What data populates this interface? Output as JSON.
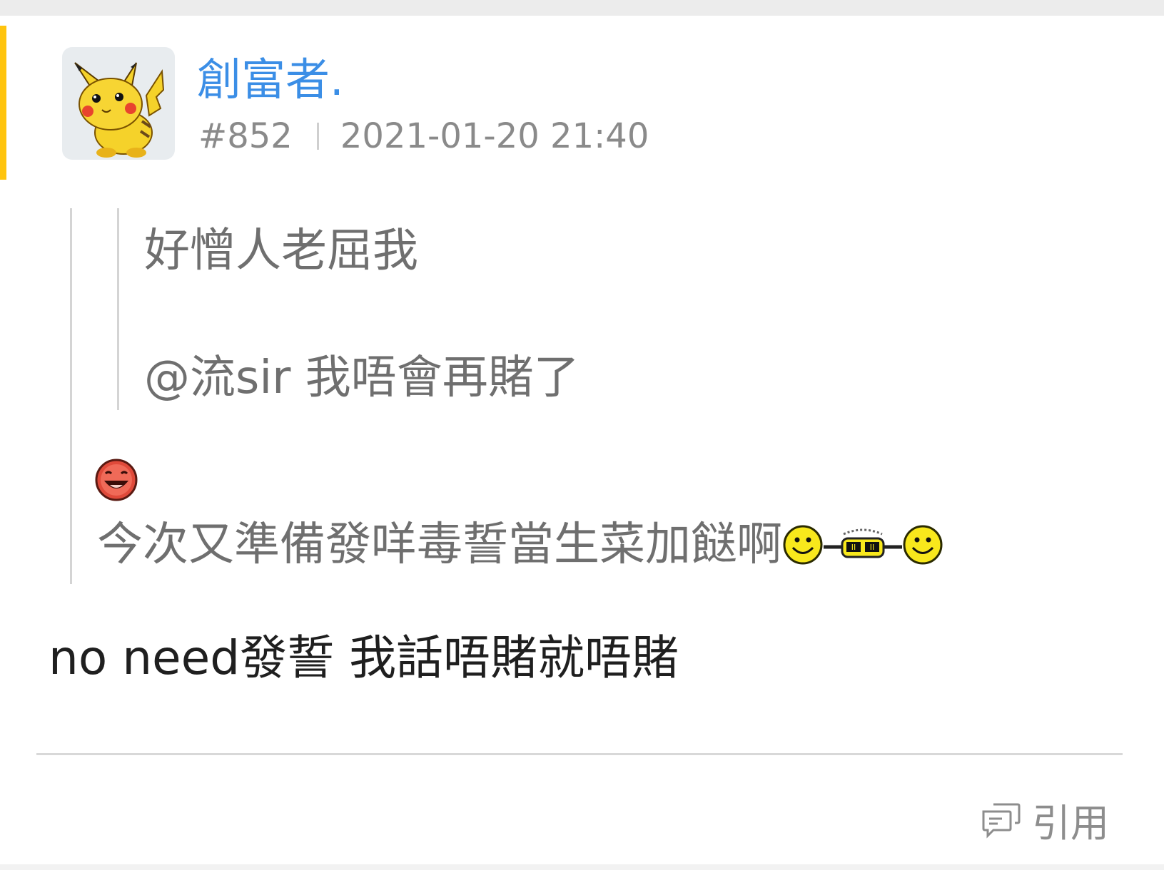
{
  "post": {
    "username": "創富者.",
    "post_number": "#852",
    "timestamp": "2021-01-20 21:40",
    "avatar_icon": "pikachu-avatar",
    "accent_color": "#ffc40d",
    "username_color": "#3b8ee6"
  },
  "quote": {
    "nested_line1": "好憎人老屈我",
    "nested_line2": "@流sir 我唔會再賭了",
    "outer_text": "今次又準備發咩毒誓當生菜加餸啊",
    "emojis": [
      "laughing-face-emoji",
      "smiley-face-emoji",
      "sunglasses-emoji",
      "smiley-face-emoji"
    ]
  },
  "reply": {
    "text": "no need發誓 我話唔賭就唔賭"
  },
  "actions": {
    "quote_label": "引用",
    "quote_icon": "chat-bubbles-icon"
  }
}
